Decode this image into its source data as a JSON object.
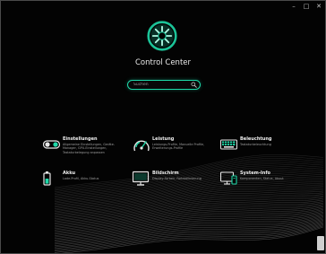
{
  "window": {
    "title": "Control Center",
    "controls": {
      "minimize": "–",
      "maximize": "□",
      "close": "✕"
    }
  },
  "search": {
    "placeholder": "Suchen",
    "value": ""
  },
  "tiles": [
    {
      "id": "einstellungen",
      "name": "Einstellungen",
      "icon": "toggle-switch-icon",
      "desc": "Allgemeine Einstellungen, Geräte-Manager, GPU-Einstellungen, Tastaturbelegung anpassen"
    },
    {
      "id": "leistung",
      "name": "Leistung",
      "icon": "speedometer-icon",
      "desc": "Leistungs-Profile, Manuelle Profile, Erweiterungs-Profile"
    },
    {
      "id": "beleuchtung",
      "name": "Beleuchtung",
      "icon": "keyboard-icon",
      "desc": "Tastaturbeleuchtung"
    },
    {
      "id": "akku",
      "name": "Akku",
      "icon": "battery-icon",
      "desc": "Lade-Profil, Akku-Status"
    },
    {
      "id": "bildschirm",
      "name": "Bildschirm",
      "icon": "monitor-icon",
      "desc": "Display-Farben, Farbkalibrierung"
    },
    {
      "id": "systeminfo",
      "name": "System-Info",
      "icon": "system-info-icon",
      "desc": "Komponenten, Status, About"
    }
  ],
  "colors": {
    "accent": "#1ed8a8",
    "background": "#030303",
    "text": "#f0f0f0",
    "muted": "#9e9e9e"
  }
}
